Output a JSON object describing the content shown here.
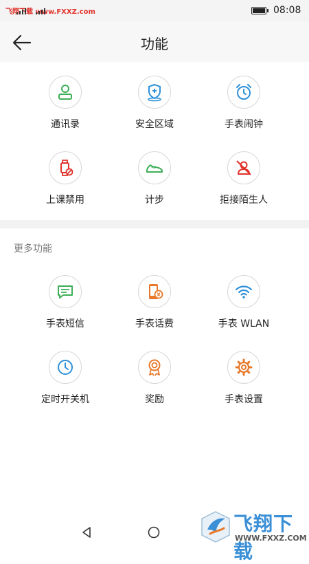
{
  "status_bar": {
    "watermark_text": "飞翔下载 www.FXXZ.com",
    "time": "08:08"
  },
  "header": {
    "title": "功能",
    "back_icon": "arrow-left-icon"
  },
  "primary_features": [
    {
      "label": "通讯录",
      "icon": "contact-icon",
      "color": "#3dae57"
    },
    {
      "label": "安全区域",
      "icon": "safe-zone-icon",
      "color": "#2e90d8"
    },
    {
      "label": "手表闹钟",
      "icon": "alarm-clock-icon",
      "color": "#2e90d8"
    },
    {
      "label": "上课禁用",
      "icon": "class-disable-icon",
      "color": "#e0322c"
    },
    {
      "label": "计步",
      "icon": "shoe-icon",
      "color": "#3dae57"
    },
    {
      "label": "拒接陌生人",
      "icon": "reject-stranger-icon",
      "color": "#e0322c"
    }
  ],
  "more_section": {
    "title": "更多功能",
    "items": [
      {
        "label": "手表短信",
        "icon": "message-icon",
        "color": "#3dae57"
      },
      {
        "label": "手表话费",
        "icon": "phone-bill-icon",
        "color": "#e8792a"
      },
      {
        "label": "手表 WLAN",
        "icon": "wifi-icon",
        "color": "#2e90d8"
      },
      {
        "label": "定时开关机",
        "icon": "timer-icon",
        "color": "#2e90d8"
      },
      {
        "label": "奖励",
        "icon": "award-icon",
        "color": "#e8792a"
      },
      {
        "label": "手表设置",
        "icon": "gear-icon",
        "color": "#e8792a"
      }
    ]
  },
  "nav_bar": {
    "back_icon": "triangle-back-icon",
    "home_icon": "circle-home-icon"
  },
  "watermark": {
    "brand": "飞翔下载",
    "url": "WWW.FXXZ.COM"
  }
}
